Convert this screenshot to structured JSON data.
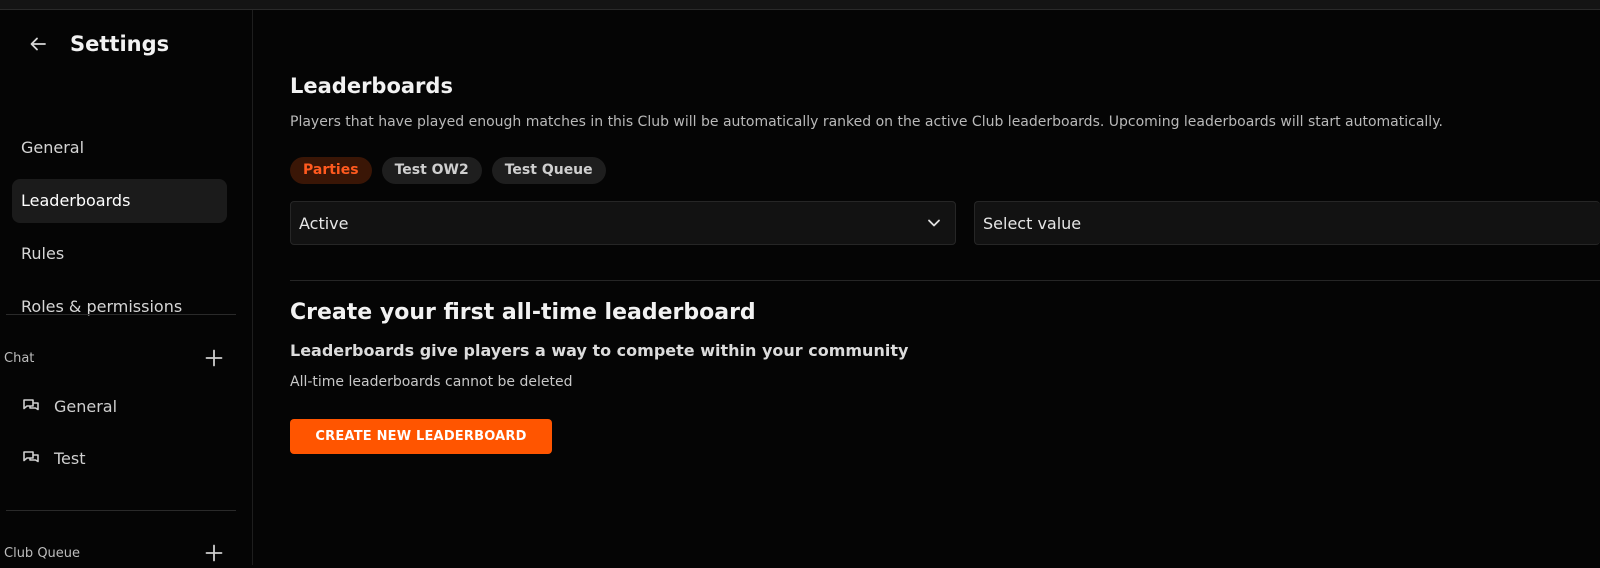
{
  "colors": {
    "accent": "#ff5500",
    "chip_active_bg": "#3a1606",
    "chip_active_text": "#ff5a1f",
    "background": "#050505"
  },
  "sidebar": {
    "title": "Settings",
    "back_icon": "arrow-left-icon",
    "items": [
      {
        "label": "General",
        "active": false
      },
      {
        "label": "Leaderboards",
        "active": true
      },
      {
        "label": "Rules",
        "active": false
      },
      {
        "label": "Roles & permissions",
        "active": false
      }
    ],
    "sections": [
      {
        "label": "Chat",
        "add_icon": "plus-icon",
        "channels": [
          {
            "label": "General",
            "icon": "chat-bubbles-icon"
          },
          {
            "label": "Test",
            "icon": "chat-bubbles-icon"
          }
        ]
      },
      {
        "label": "Club Queue",
        "add_icon": "plus-icon"
      }
    ]
  },
  "main": {
    "title": "Leaderboards",
    "description": "Players that have played enough matches in this Club will be automatically ranked on the active Club leaderboards. Upcoming leaderboards will start automatically.",
    "chips": [
      {
        "label": "Parties",
        "active": true
      },
      {
        "label": "Test OW2",
        "active": false
      },
      {
        "label": "Test Queue",
        "active": false
      }
    ],
    "status_select": {
      "value": "Active",
      "icon": "chevron-down-icon"
    },
    "value_select": {
      "placeholder": "Select value"
    },
    "empty_state": {
      "title": "Create your first all-time leaderboard",
      "subtitle": "Leaderboards give players a way to compete within your community",
      "note": "All-time leaderboards cannot be deleted",
      "button_label": "CREATE NEW LEADERBOARD"
    }
  }
}
